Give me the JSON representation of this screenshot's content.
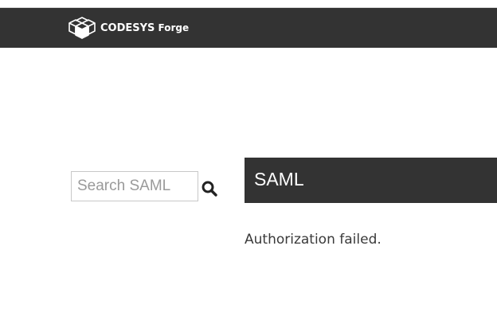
{
  "header": {
    "brand_bold": "CODESYS",
    "brand_rest": "Forge",
    "logo_icon": "codesys-cube-logo-icon"
  },
  "search": {
    "placeholder": "Search SAML",
    "value": "",
    "icon": "search-icon"
  },
  "main": {
    "title": "SAML",
    "message": "Authorization failed."
  },
  "colors": {
    "header_bg": "#333333",
    "title_bg": "#333333",
    "text": "#3a3a3a"
  }
}
